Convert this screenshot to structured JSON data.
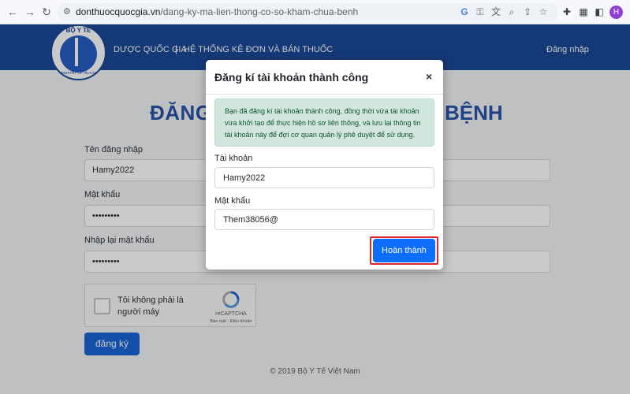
{
  "browser": {
    "back": "←",
    "forward": "→",
    "reload": "↻",
    "lock_icon": "tune-icon",
    "url_host": "donthuocquocgia.vn",
    "url_path": "/dang-ky-ma-lien-thong-co-so-kham-chua-benh",
    "profile_initial": "H"
  },
  "header": {
    "logo_top": "BỘ Y TẾ",
    "logo_bottom": "MINISTRY OF HEALTH",
    "nav_left": "DƯỢC QUỐC GIA",
    "separator": "|",
    "nav_right": "HỆ THỐNG KÊ ĐƠN VÀ BÁN THUỐC",
    "login": "Đăng nhập"
  },
  "page": {
    "title_left": "ĐĂNG",
    "title_right": "BỆNH",
    "username_label": "Tên đăng nhập",
    "username_value": "Hamy2022",
    "password_label": "Mật khẩu",
    "password_value": "•••••••••",
    "confirm_label": "Nhập lại mật khẩu",
    "confirm_value": "•••••••••",
    "captcha_text": "Tôi không phải là người máy",
    "captcha_brand": "reCAPTCHA",
    "captcha_links": "Bảo mật - Điều khoản",
    "register_button": "đăng ký",
    "footer": "© 2019 Bộ Y Tế Việt Nam"
  },
  "modal": {
    "title": "Đăng kí tài khoản thành công",
    "close": "×",
    "alert": "Bạn đã đăng kí tài khoản thành công, đồng thời vừa tài khoản vừa khởi tạo để thực hiện hồ sơ liên thông, và lưu lại thông tin tài khoản này để đợi cơ quan quản lý phê duyệt để sử dụng.",
    "account_label": "Tài khoản",
    "account_value": "Hamy2022",
    "password_label": "Mật khẩu",
    "password_value": "Them38056@",
    "finish_button": "Hoàn thành"
  },
  "colors": {
    "header_bg": "#0f3e92",
    "primary": "#0d6efd",
    "alert_bg": "#d1e7dd",
    "highlight": "#e0232c"
  }
}
